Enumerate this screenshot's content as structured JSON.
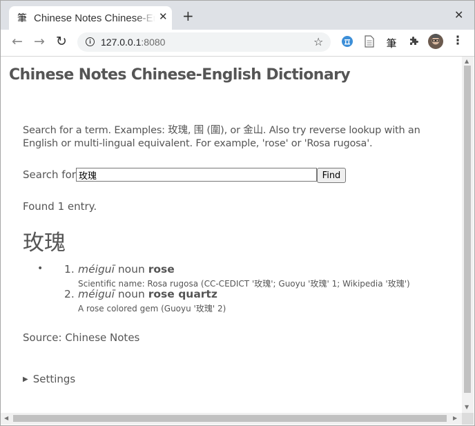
{
  "browser": {
    "tab": {
      "favicon": "筆",
      "title": "Chinese Notes Chinese-English Dictionary",
      "close": "✕"
    },
    "new_tab": "+",
    "window_close": "✕",
    "url": {
      "host": "127.0.0.1",
      "port": ":8080"
    },
    "nav_icons": {
      "back": "←",
      "forward": "→",
      "reload": "↻"
    },
    "star": "☆",
    "extensions": [
      {
        "name": "translate-extension-icon",
        "glyph": "🏛"
      },
      {
        "name": "document-extension-icon",
        "glyph": "▤"
      },
      {
        "name": "bi-extension-icon",
        "glyph": "筆"
      },
      {
        "name": "puzzle-extensions-icon",
        "glyph": "✚"
      }
    ],
    "menu": "⋮"
  },
  "page": {
    "title": "Chinese Notes Chinese-English Dictionary",
    "intro": "Search for a term. Examples: 玫瑰, 围 (圍), or 金山. Also try reverse lookup with an English or multi-lingual equivalent. For example, 'rose' or 'Rosa rugosa'.",
    "search": {
      "label": "Search for",
      "value": "玫瑰",
      "button": "Find"
    },
    "found": "Found 1 entry.",
    "entry": {
      "headword": "玫瑰",
      "bullet": "•",
      "senses": [
        {
          "num": "1.",
          "pinyin": "méiguī",
          "pos": "noun",
          "english": "rose",
          "note": "Scientific name: Rosa rugosa (CC-CEDICT '玫瑰'; Guoyu '玫瑰' 1; Wikipedia '玫瑰')"
        },
        {
          "num": "2.",
          "pinyin": "méiguī",
          "pos": "noun",
          "english": "rose quartz",
          "note": "A rose colored gem (Guoyu '玫瑰' 2)"
        }
      ]
    },
    "source": "Source: Chinese Notes",
    "settings": {
      "triangle": "▶",
      "label": "Settings"
    }
  }
}
